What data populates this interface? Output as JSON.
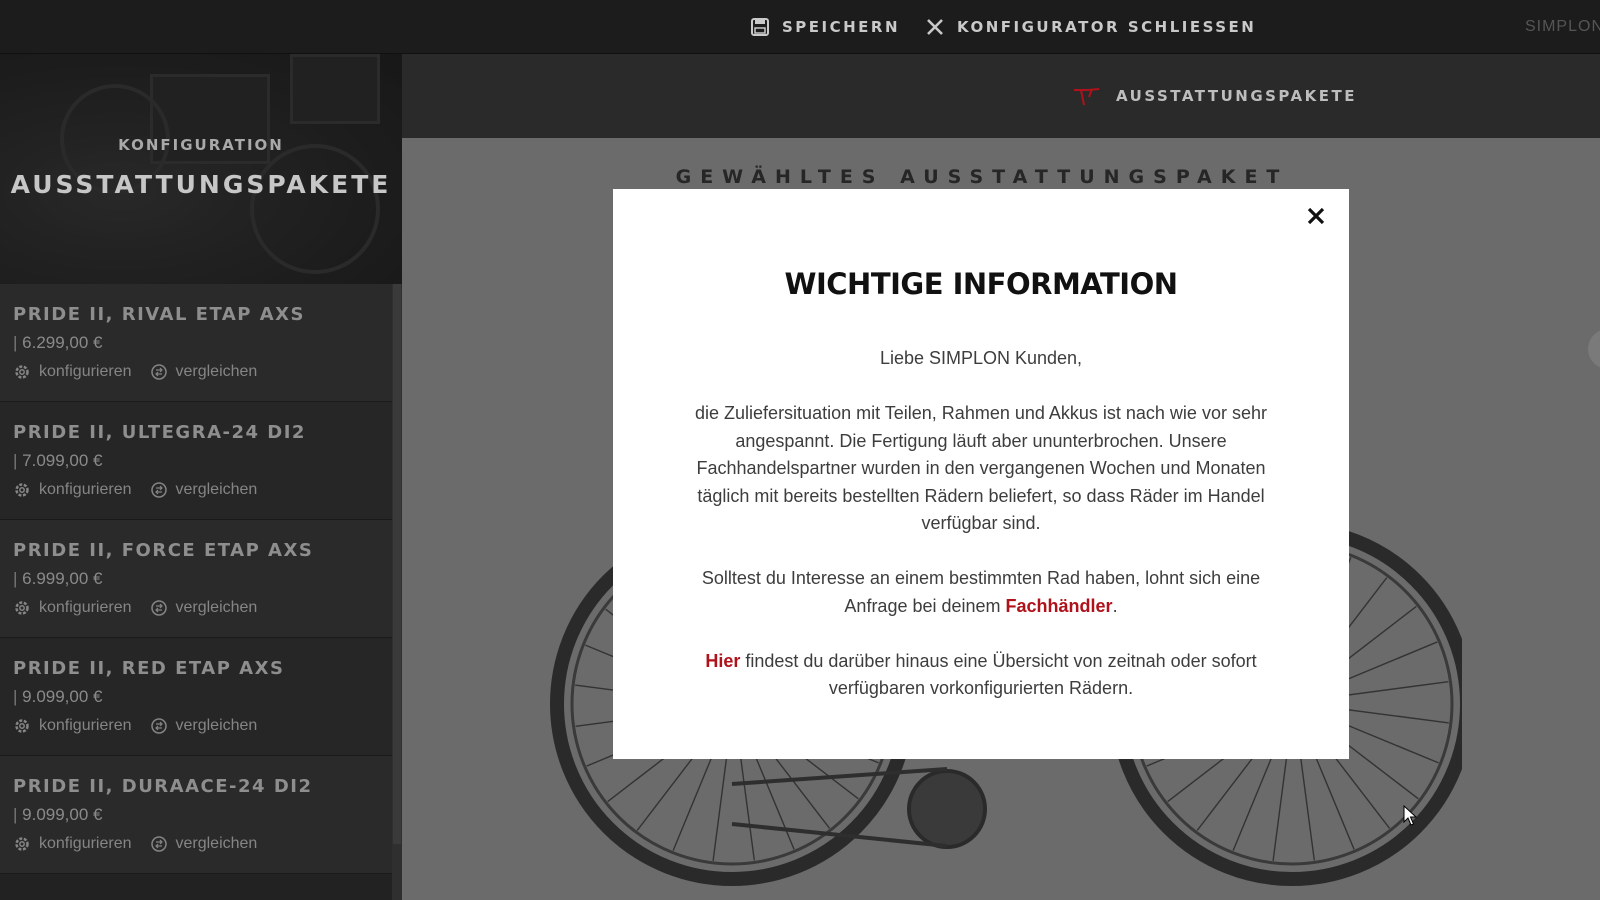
{
  "topbar": {
    "save_label": "SPEICHERN",
    "close_label": "KONFIGURATOR SCHLIESSEN",
    "brand": "SIMPLON"
  },
  "sidebar": {
    "hero_subtitle": "KONFIGURATION",
    "hero_title": "AUSSTATTUNGSPAKETE",
    "packages": [
      {
        "name": "PRIDE II, RIVAL ETAP AXS",
        "price": "6.299,00 €",
        "configure": "konfigurieren",
        "compare": "vergleichen"
      },
      {
        "name": "PRIDE II, ULTEGRA-24 DI2",
        "price": "7.099,00 €",
        "configure": "konfigurieren",
        "compare": "vergleichen"
      },
      {
        "name": "PRIDE II, FORCE ETAP AXS",
        "price": "6.999,00 €",
        "configure": "konfigurieren",
        "compare": "vergleichen"
      },
      {
        "name": "PRIDE II, RED ETAP AXS",
        "price": "9.099,00 €",
        "configure": "konfigurieren",
        "compare": "vergleichen"
      },
      {
        "name": "PRIDE II, DURAACE-24 DI2",
        "price": "9.099,00 €",
        "configure": "konfigurieren",
        "compare": "vergleichen"
      }
    ]
  },
  "main": {
    "tab_label": "AUSSTATTUNGSPAKETE",
    "section_title": "GEWÄHLTES AUSSTATTUNGSPAKET"
  },
  "modal": {
    "title": "WICHTIGE INFORMATION",
    "greeting": "Liebe SIMPLON Kunden,",
    "paragraph1": "die Zuliefersituation mit Teilen, Rahmen und Akkus ist nach wie vor sehr angespannt. Die Fertigung läuft aber ununterbrochen. Unsere Fachhandelspartner wurden in den vergangenen Wochen und Monaten täglich mit bereits bestellten Rädern beliefert, so dass Räder im Handel verfügbar sind.",
    "paragraph2_before": "Solltest du Interesse an einem bestimmten Rad haben, lohnt sich eine Anfrage bei deinem ",
    "paragraph2_link": "Fachhändler",
    "paragraph2_after": ".",
    "paragraph3_link": "Hier",
    "paragraph3_after": " findest du darüber hinaus eine Übersicht von zeitnah oder sofort verfügbaren vorkonfigurierten Rädern."
  },
  "colors": {
    "accent": "#b0121b",
    "topbar": "#1c1c1c",
    "sidebar": "#222222",
    "overlay": "#6b6b6b"
  }
}
